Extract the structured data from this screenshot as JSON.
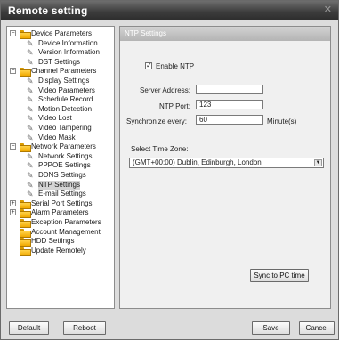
{
  "window": {
    "title": "Remote setting",
    "close_icon": "close-icon"
  },
  "tree": {
    "nodes": [
      {
        "label": "Device Parameters",
        "kind": "folder",
        "expanded": true,
        "level": 0
      },
      {
        "label": "Device Information",
        "kind": "leaf",
        "level": 1
      },
      {
        "label": "Version Information",
        "kind": "leaf",
        "level": 1
      },
      {
        "label": "DST Settings",
        "kind": "leaf",
        "level": 1
      },
      {
        "label": "Channel Parameters",
        "kind": "folder",
        "expanded": true,
        "level": 0
      },
      {
        "label": "Display Settings",
        "kind": "leaf",
        "level": 1
      },
      {
        "label": "Video Parameters",
        "kind": "leaf",
        "level": 1
      },
      {
        "label": "Schedule Record",
        "kind": "leaf",
        "level": 1
      },
      {
        "label": "Motion Detection",
        "kind": "leaf",
        "level": 1
      },
      {
        "label": "Video Lost",
        "kind": "leaf",
        "level": 1
      },
      {
        "label": "Video Tampering",
        "kind": "leaf",
        "level": 1
      },
      {
        "label": "Video Mask",
        "kind": "leaf",
        "level": 1
      },
      {
        "label": "Network Parameters",
        "kind": "folder",
        "expanded": true,
        "level": 0
      },
      {
        "label": "Network Settings",
        "kind": "leaf",
        "level": 1
      },
      {
        "label": "PPPOE Settings",
        "kind": "leaf",
        "level": 1
      },
      {
        "label": "DDNS Settings",
        "kind": "leaf",
        "level": 1
      },
      {
        "label": "NTP Settings",
        "kind": "leaf",
        "level": 1,
        "selected": true
      },
      {
        "label": "E-mail Settings",
        "kind": "leaf",
        "level": 1
      },
      {
        "label": "Serial Port Settings",
        "kind": "folder",
        "expanded": false,
        "level": 0
      },
      {
        "label": "Alarm Parameters",
        "kind": "folder",
        "expanded": false,
        "level": 0
      },
      {
        "label": "Exception Parameters",
        "kind": "folder",
        "level": 0
      },
      {
        "label": "Account Management",
        "kind": "folder",
        "level": 0
      },
      {
        "label": "HDD Settings",
        "kind": "folder",
        "level": 0
      },
      {
        "label": "Update Remotely",
        "kind": "folder",
        "level": 0
      }
    ]
  },
  "ntp": {
    "header": "NTP Settings",
    "enable_label": "Enable NTP",
    "enable_checked": true,
    "server_label": "Server Address:",
    "server_value": "",
    "port_label": "NTP Port:",
    "port_value": "123",
    "sync_label": "Synchronize every:",
    "sync_value": "60",
    "sync_unit": "Minute(s)",
    "timezone_label": "Select Time Zone:",
    "timezone_value": "(GMT+00:00) Dublin, Edinburgh, London",
    "sync_pc_button": "Sync to PC time"
  },
  "footer": {
    "default_button": "Default",
    "reboot_button": "Reboot",
    "save_button": "Save",
    "cancel_button": "Cancel"
  }
}
